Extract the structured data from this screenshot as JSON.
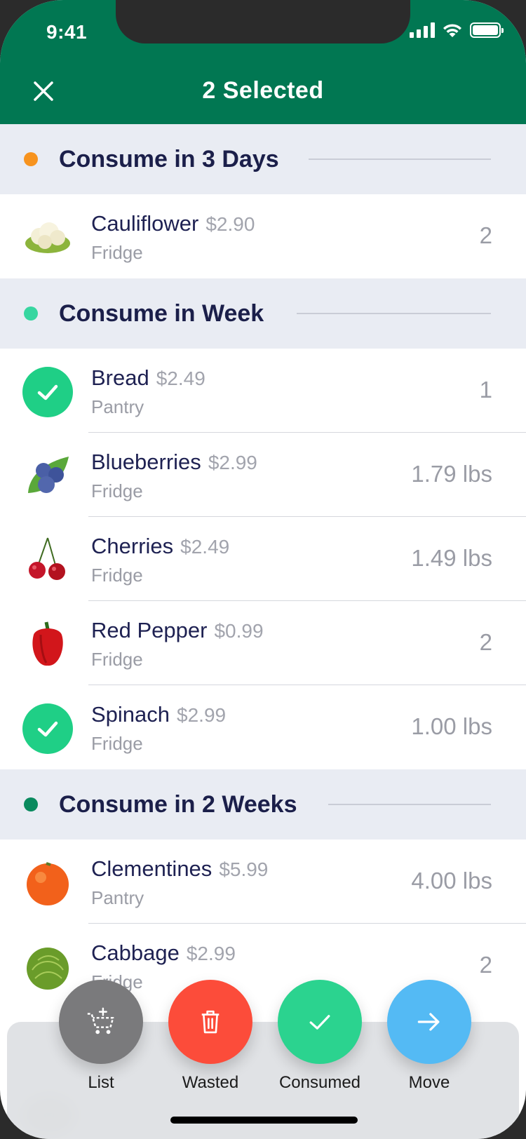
{
  "status_bar": {
    "time": "9:41"
  },
  "header": {
    "title": "2 Selected",
    "bg_color": "#017752"
  },
  "sections": [
    {
      "title": "Consume in 3 Days",
      "dot_color": "#f7931e",
      "items": [
        {
          "name": "Cauliflower",
          "price": "$2.90",
          "location": "Fridge",
          "qty": "2",
          "selected": false,
          "icon": "cauliflower-icon"
        }
      ]
    },
    {
      "title": "Consume in Week",
      "dot_color": "#37d6a0",
      "items": [
        {
          "name": "Bread",
          "price": "$2.49",
          "location": "Pantry",
          "qty": "1",
          "selected": true,
          "icon": "check-icon"
        },
        {
          "name": "Blueberries",
          "price": "$2.99",
          "location": "Fridge",
          "qty": "1.79 lbs",
          "selected": false,
          "icon": "blueberries-icon"
        },
        {
          "name": "Cherries",
          "price": "$2.49",
          "location": "Fridge",
          "qty": "1.49 lbs",
          "selected": false,
          "icon": "cherries-icon"
        },
        {
          "name": "Red Pepper",
          "price": "$0.99",
          "location": "Fridge",
          "qty": "2",
          "selected": false,
          "icon": "red-pepper-icon"
        },
        {
          "name": "Spinach",
          "price": "$2.99",
          "location": "Fridge",
          "qty": "1.00 lbs",
          "selected": true,
          "icon": "check-icon"
        }
      ]
    },
    {
      "title": "Consume in 2 Weeks",
      "dot_color": "#0a8a5e",
      "items": [
        {
          "name": "Clementines",
          "price": "$5.99",
          "location": "Pantry",
          "qty": "4.00 lbs",
          "selected": false,
          "icon": "clementine-icon"
        },
        {
          "name": "Cabbage",
          "price": "$2.99",
          "location": "Fridge",
          "qty": "2",
          "selected": false,
          "icon": "cabbage-icon"
        }
      ]
    }
  ],
  "actions": [
    {
      "label": "List",
      "color": "#7a7a7c",
      "icon": "add-to-cart-icon"
    },
    {
      "label": "Wasted",
      "color": "#fc4c3a",
      "icon": "trash-icon"
    },
    {
      "label": "Consumed",
      "color": "#2bd38f",
      "icon": "checkmark-icon"
    },
    {
      "label": "Move",
      "color": "#54baf4",
      "icon": "arrow-right-icon"
    }
  ]
}
